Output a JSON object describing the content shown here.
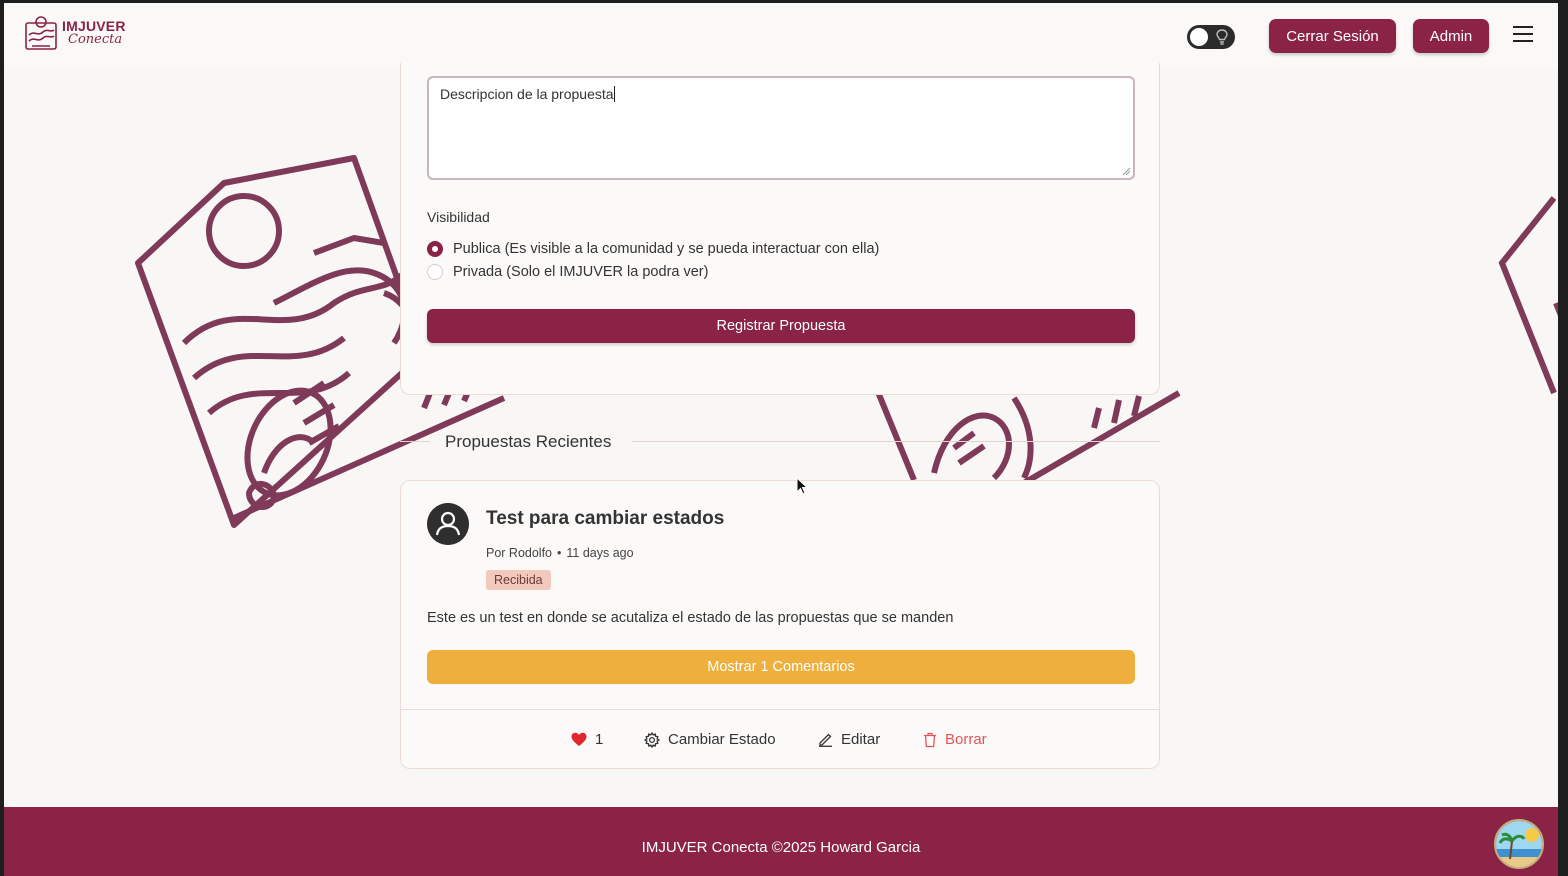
{
  "header": {
    "logo_title": "IMJUVER",
    "logo_subtitle": "Conecta",
    "logout_label": "Cerrar Sesión",
    "admin_label": "Admin"
  },
  "form": {
    "description_value": "Descripcion de la propuesta",
    "visibility_label": "Visibilidad",
    "options": [
      {
        "label": "Publica (Es visible a la comunidad y se pueda interactuar con ella)",
        "checked": true
      },
      {
        "label": "Privada (Solo el IMJUVER la podra ver)",
        "checked": false
      }
    ],
    "submit_label": "Registrar Propuesta"
  },
  "recent": {
    "section_title": "Propuestas Recientes",
    "proposal": {
      "title": "Test para cambiar estados",
      "author": "Por Rodolfo",
      "time_ago": "11 days ago",
      "status": "Recibida",
      "body": "Este es un test en donde se acutaliza el estado de las propuestas que se manden",
      "comments_label": "Mostrar 1 Comentarios",
      "likes": "1",
      "change_status_label": "Cambiar Estado",
      "edit_label": "Editar",
      "delete_label": "Borrar"
    }
  },
  "footer": {
    "text": "IMJUVER Conecta ©2025 Howard Garcia"
  },
  "colors": {
    "brand": "#8a2346",
    "accent": "#eeaf3d",
    "badge_bg": "#f2c9bd",
    "delete": "#e2555b"
  }
}
